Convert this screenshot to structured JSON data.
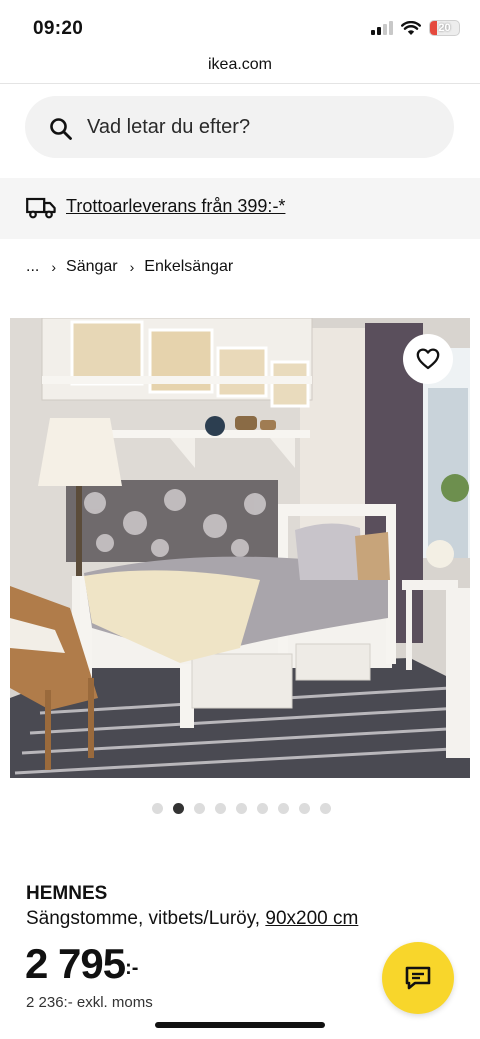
{
  "status_bar": {
    "time": "09:20",
    "battery": "20"
  },
  "browser": {
    "url": "ikea.com"
  },
  "search": {
    "placeholder": "Vad letar du efter?"
  },
  "delivery": {
    "text": "Trottoarleverans från 399:-*"
  },
  "breadcrumb": {
    "root": "...",
    "items": [
      "Sängar",
      "Enkelsängar"
    ]
  },
  "product": {
    "name": "HEMNES",
    "description": "Sängstomme, vitbets/Luröy, ",
    "size": "90x200 cm",
    "price": "2 795",
    "price_suffix": ":-",
    "price_excl_vat": "2 236:- exkl. moms"
  },
  "carousel": {
    "total": 9,
    "active_index": 1
  },
  "colors": {
    "chat_button": "#f8d62b",
    "delivery_bg": "#f5f5f5",
    "search_bg": "#f2f2f2"
  }
}
